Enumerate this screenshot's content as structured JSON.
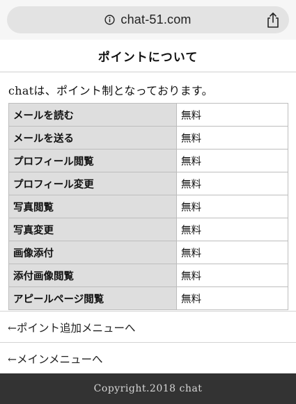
{
  "browser": {
    "url": "chat-51.com"
  },
  "header": {
    "title": "ポイントについて"
  },
  "intro": "chatは、ポイント制となっております。",
  "points_table": {
    "rows": [
      {
        "label": "メールを読む",
        "value": "無料"
      },
      {
        "label": "メールを送る",
        "value": "無料"
      },
      {
        "label": "プロフィール閲覧",
        "value": "無料"
      },
      {
        "label": "プロフィール変更",
        "value": "無料"
      },
      {
        "label": "写真閲覧",
        "value": "無料"
      },
      {
        "label": "写真変更",
        "value": "無料"
      },
      {
        "label": "画像添付",
        "value": "無料"
      },
      {
        "label": "添付画像閲覧",
        "value": "無料"
      },
      {
        "label": "アピールページ閲覧",
        "value": "無料"
      }
    ]
  },
  "nav": {
    "add_points": "←ポイント追加メニューへ",
    "main_menu": "←メインメニューへ"
  },
  "footer": {
    "copyright": "Copyright.2018 chat"
  },
  "icons": {
    "info": "info-icon",
    "share": "share-icon"
  },
  "colors": {
    "footer_bg": "#333333",
    "table_label_bg": "#dedede",
    "url_pill_bg": "#e3e3e3"
  }
}
